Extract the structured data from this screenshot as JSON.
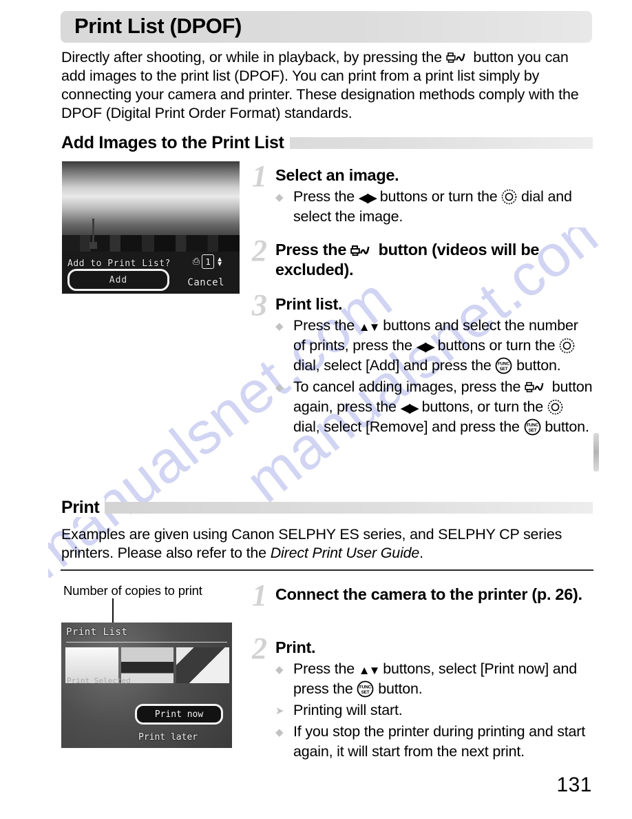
{
  "document": {
    "title": "Print List (DPOF)",
    "page_number": "131",
    "watermark": "manualsnet.com"
  },
  "intro": {
    "part1": "Directly after shooting, or while in playback, by pressing the ",
    "icon": "print-dpof-icon",
    "part2": " button you can add images to the print list (DPOF). You can print from a print list simply by connecting your camera and printer. These designation methods comply with the DPOF (Digital Print Order Format) standards."
  },
  "sections": [
    {
      "id": "add-images",
      "heading": "Add Images to the Print List"
    },
    {
      "id": "print",
      "heading": "Print"
    }
  ],
  "print_section": {
    "paragraph_1": "Examples are given using Canon SELPHY ES series, and SELPHY CP series printers. Please also refer to the ",
    "paragraph_italic": "Direct Print User Guide",
    "paragraph_2": "."
  },
  "screens": {
    "add_to_print_list": {
      "name": "add-to-print-list-screen",
      "osd_prompt": "Add to Print List?",
      "button_selected": "Add",
      "button_plain": "Cancel",
      "copies_count": "1"
    },
    "print_list": {
      "name": "print-list-screen",
      "header": "Print List",
      "option_selected": "Print now",
      "option_plain": "Print later",
      "sub_caption": "Print Selected"
    }
  },
  "callout": {
    "label": "Number of copies to print"
  },
  "steps": [
    {
      "number": "1",
      "title": "Select an image.",
      "bullets": [
        {
          "bullet_type": "dot",
          "seg1": "Press the ",
          "icon1": "left-right-buttons-icon",
          "seg2": " buttons or turn the ",
          "icon2": "control-dial-icon",
          "seg3": " dial and select the image."
        }
      ]
    },
    {
      "number": "2",
      "title_seg1": "Press the ",
      "title_icon": "print-dpof-icon",
      "title_seg2": " button (videos will be excluded).",
      "bullets": []
    },
    {
      "number": "3",
      "title": "Print list.",
      "bullets": [
        {
          "bullet_type": "dot",
          "seg1": "Press the ",
          "icon1": "up-down-buttons-icon",
          "seg2": " buttons and select the number of prints, press the ",
          "icon2": "left-right-buttons-icon",
          "seg3": " buttons or turn the ",
          "icon3": "control-dial-icon",
          "seg4": " dial, select [Add] and press the ",
          "icon4": "func-set-button-icon",
          "seg5": " button."
        },
        {
          "bullet_type": "dot",
          "seg1": "To cancel adding images, press the ",
          "icon1": "print-dpof-icon",
          "seg2": " button again, press the ",
          "icon2": "left-right-buttons-icon",
          "seg3": " buttons, or turn the ",
          "icon3": "control-dial-icon",
          "seg4": " dial, select [Remove] and press the ",
          "icon4": "func-set-button-icon",
          "seg5": " button."
        }
      ]
    },
    {
      "number": "1",
      "title": "Connect the camera to the printer (p. 26).",
      "bullets": []
    },
    {
      "number": "2",
      "title": "Print.",
      "bullets": [
        {
          "bullet_type": "dot",
          "seg1": "Press the ",
          "icon1": "up-down-buttons-icon",
          "seg2": " buttons, select [Print now] and press the ",
          "icon2": "func-set-button-icon",
          "seg3": " button."
        },
        {
          "bullet_type": "arrow",
          "text": "Printing will start."
        },
        {
          "bullet_type": "dot",
          "text": "If you stop the printer during printing and start again, it will start from the next print."
        }
      ]
    }
  ],
  "icons": {
    "func_set_line1": "FUNC",
    "func_set_line2": "SET"
  },
  "colors": {
    "heading_bar": "#dedede",
    "step_number": "#d2d2d2",
    "watermark": "#c9cdf0",
    "text": "#000000"
  }
}
